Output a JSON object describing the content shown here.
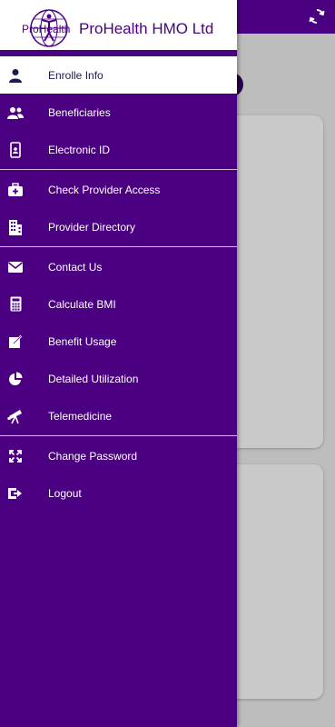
{
  "app": {
    "logo_text": "ProHealth",
    "title": "ProHealth HMO Ltd"
  },
  "colors": {
    "brand": "#4b0082",
    "active_bg": "#ffffff",
    "overlay": "#bdbdbd"
  },
  "topbar": {
    "refresh_icon": "refresh-icon"
  },
  "menu": {
    "groups": [
      [
        {
          "label": "Enrolle Info",
          "icon": "person-icon",
          "active": true
        },
        {
          "label": "Beneficiaries",
          "icon": "people-icon"
        },
        {
          "label": "Electronic ID",
          "icon": "phone-id-icon"
        }
      ],
      [
        {
          "label": "Check Provider Access",
          "icon": "medical-bag-icon"
        },
        {
          "label": "Provider Directory",
          "icon": "building-icon"
        }
      ],
      [
        {
          "label": "Contact Us",
          "icon": "envelope-icon"
        },
        {
          "label": "Calculate BMI",
          "icon": "calculator-icon"
        },
        {
          "label": "Benefit Usage",
          "icon": "edit-icon"
        },
        {
          "label": "Detailed Utilization",
          "icon": "pie-chart-icon"
        },
        {
          "label": "Telemedicine",
          "icon": "telescope-icon"
        }
      ],
      [
        {
          "label": "Change Password",
          "icon": "expand-arrows-icon"
        },
        {
          "label": "Logout",
          "icon": "logout-icon"
        }
      ]
    ]
  }
}
